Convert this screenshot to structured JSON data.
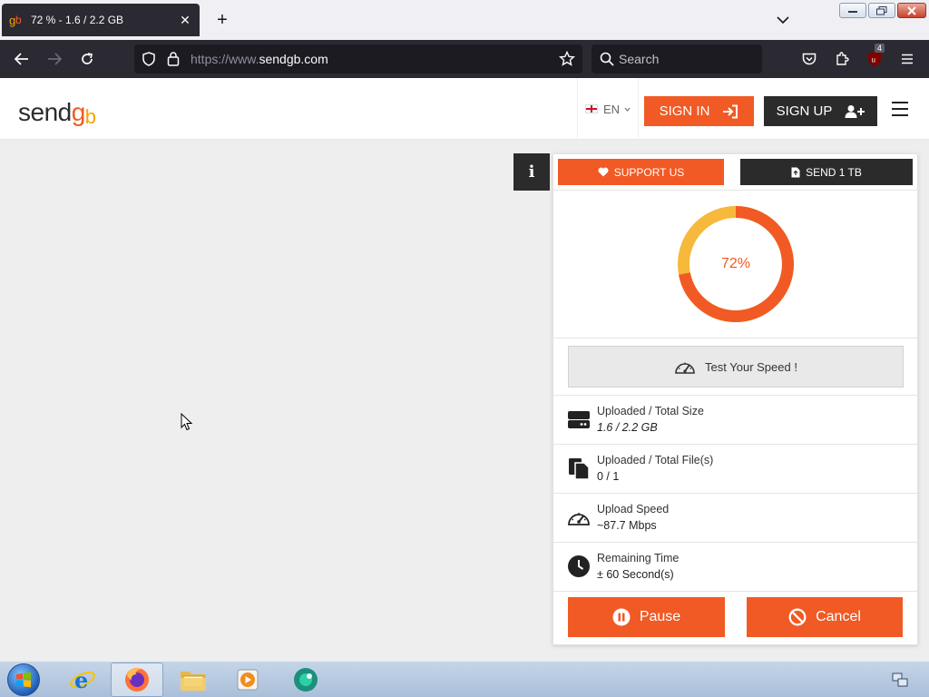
{
  "browser": {
    "tab_title": "72 % - 1.6 / 2.2 GB",
    "url_scheme": "https://www.",
    "url_host": "sendgb.com",
    "search_placeholder": "Search",
    "extension_badge": "4"
  },
  "header": {
    "logo_send": "send",
    "logo_g": "g",
    "logo_b": "b",
    "language": "EN",
    "signin_label": "SIGN IN",
    "signup_label": "SIGN UP"
  },
  "panel": {
    "info_label": "i",
    "support_label": "SUPPORT US",
    "send1tb_label": "SEND 1 TB",
    "progress_percent": 72,
    "progress_label": "72%",
    "speedtest_label": "Test Your Speed !",
    "stats": [
      {
        "label": "Uploaded / Total Size",
        "value": "1.6 / 2.2 GB"
      },
      {
        "label": "Uploaded / Total File(s)",
        "value": "0 / 1"
      },
      {
        "label": "Upload Speed",
        "value": "~87.7 Mbps"
      },
      {
        "label": "Remaining Time",
        "value": "± 60 Second(s)"
      }
    ],
    "pause_label": "Pause",
    "cancel_label": "Cancel"
  },
  "colors": {
    "brand_orange": "#f15a24",
    "progress_track": "#f6b93b",
    "dark": "#2b2b2b"
  }
}
